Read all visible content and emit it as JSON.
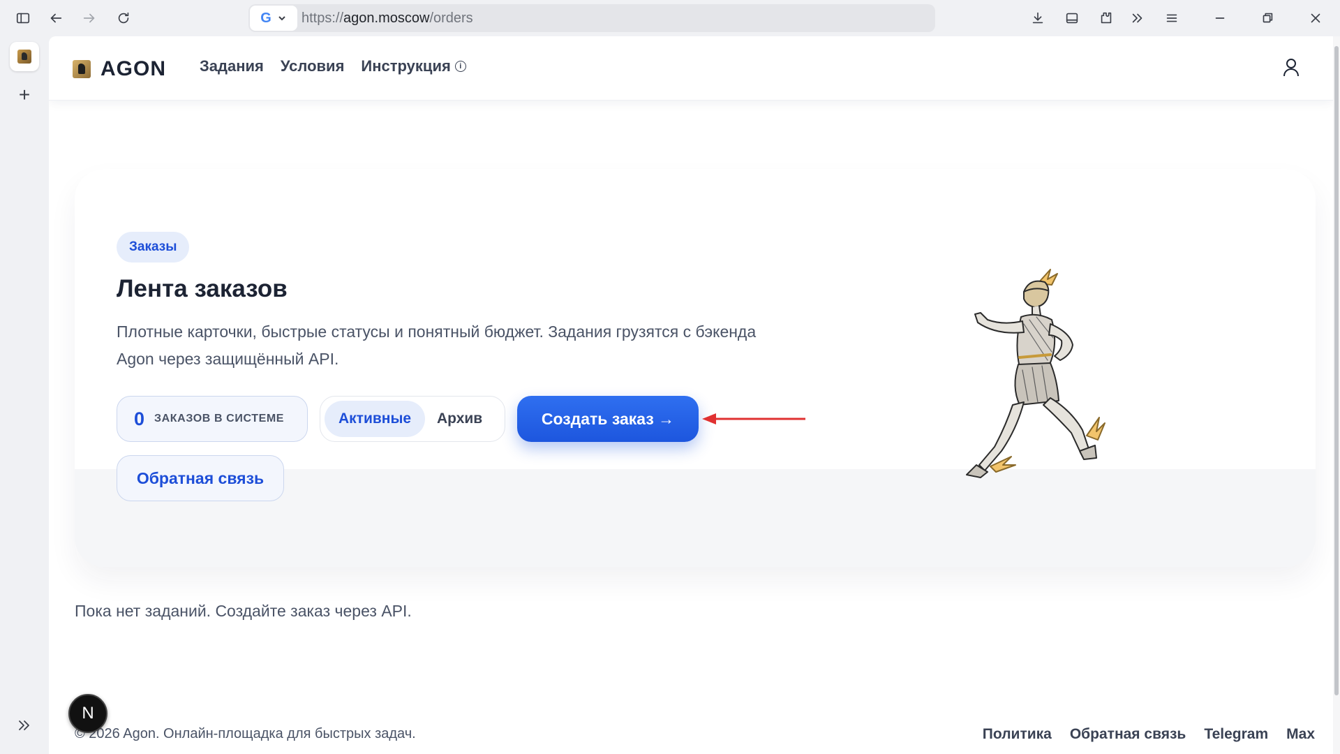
{
  "browser": {
    "url_prefix": "https://",
    "url_host": "agon.moscow",
    "url_path": "/orders",
    "search_engine_icon": "G",
    "new_tab_label": "+"
  },
  "header": {
    "brand": "AGON",
    "nav": [
      "Задания",
      "Условия",
      "Инструкция"
    ],
    "info_icon_glyph": "i"
  },
  "hero": {
    "badge": "Заказы",
    "title": "Лента заказов",
    "description": "Плотные карточки, быстрые статусы и понятный бюджет. Задания грузятся с бэкенда Agon через защищённый API.",
    "counter_value": "0",
    "counter_label": "ЗАКАЗОВ В СИСТЕМЕ",
    "filter_active": "Активные",
    "filter_archive": "Архив",
    "create_button": "Создать заказ →",
    "feedback_button": "Обратная связь"
  },
  "empty_state": "Пока нет заданий. Создайте заказ через API.",
  "footer": {
    "copyright": "© 2026 Agon. Онлайн-площадка для быстрых задач.",
    "links": [
      "Политика",
      "Обратная связь",
      "Telegram",
      "Max"
    ]
  },
  "dev_badge": "N",
  "colors": {
    "accent": "#1d4ed8",
    "button": "#2563eb",
    "annotation_arrow": "#e03131"
  }
}
